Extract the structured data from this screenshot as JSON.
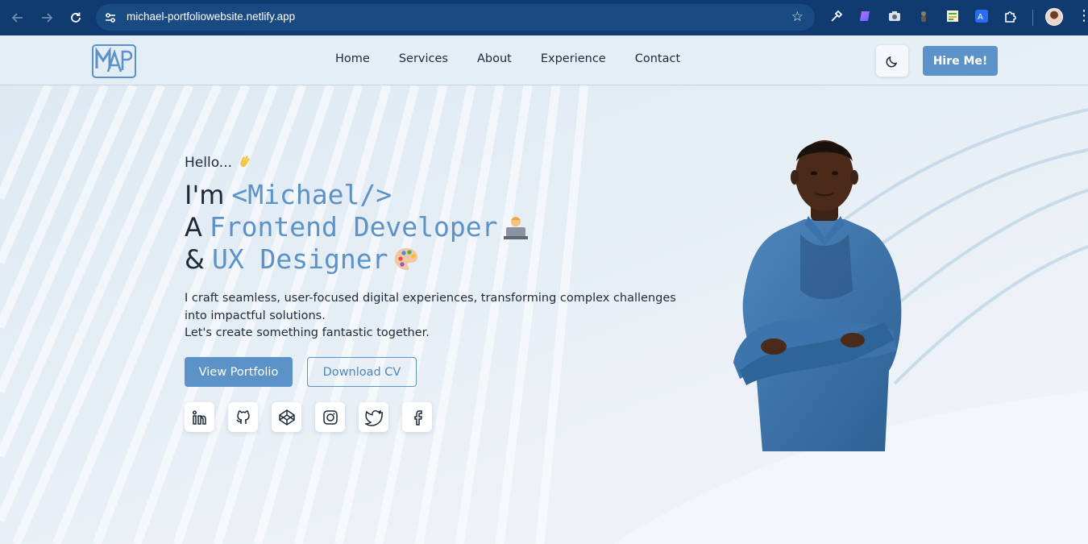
{
  "browser": {
    "url": "michael-portfoliowebsite.netlify.app",
    "icons": [
      "back-arrow-icon",
      "forward-arrow-icon",
      "reload-icon",
      "site-settings-icon",
      "bookmark-star-icon",
      "eyedropper-extension-icon",
      "gradient-extension-icon",
      "camera-extension-icon",
      "extension-icon",
      "sheet-extension-icon",
      "translate-extension-icon",
      "puzzle-extensions-icon",
      "profile-avatar",
      "menu-kebab-icon"
    ]
  },
  "header": {
    "logo_text": "MAP",
    "nav": [
      "Home",
      "Services",
      "About",
      "Experience",
      "Contact"
    ],
    "hire_label": "Hire Me!"
  },
  "hero": {
    "greeting": "Hello...",
    "line1_prefix": "I'm",
    "line1_name": "<Michael/>",
    "line2_prefix": "A",
    "line2_role": "Frontend Developer",
    "line3_prefix": "&",
    "line3_role": "UX Designer",
    "description_1": "I craft seamless, user-focused digital experiences, transforming complex challenges into impactful solutions.",
    "description_2": "Let's create something fantastic together.",
    "primary_button": "View Portfolio",
    "secondary_button": "Download CV",
    "social_icons": [
      "linkedin-icon",
      "github-icon",
      "codepen-icon",
      "instagram-icon",
      "twitter-icon",
      "facebook-icon"
    ]
  },
  "colors": {
    "browser_chrome": "#0f3b70",
    "accent": "#5b93c8",
    "text": "#1c2a3a",
    "background": "#e8eef4"
  }
}
